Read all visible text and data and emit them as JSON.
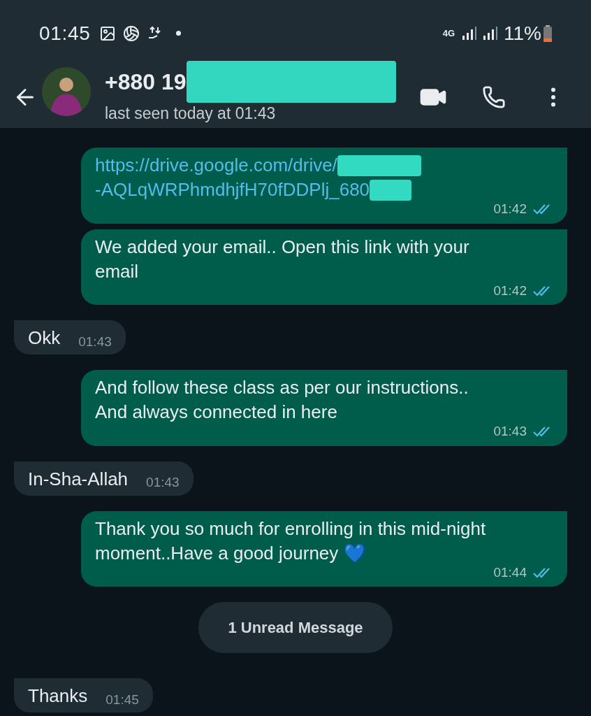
{
  "status_bar": {
    "time": "01:45",
    "network": "4G",
    "battery": "11%"
  },
  "header": {
    "name": "+880 19",
    "status": "last seen today at 01:43"
  },
  "messages": [
    {
      "kind": "link",
      "outgoing": true,
      "lines": [
        "https://drive.google.com/drive/",
        "-AQLqWRPhmdhjfH70fDDPlj_680"
      ],
      "time": "01:42",
      "read": true
    },
    {
      "kind": "text",
      "outgoing": true,
      "lines": [
        "We added your email.. Open this link with your",
        "email"
      ],
      "time": "01:42",
      "read": true
    },
    {
      "kind": "text",
      "outgoing": false,
      "lines": [
        "Okk"
      ],
      "time": "01:43"
    },
    {
      "kind": "text",
      "outgoing": true,
      "lines": [
        "And follow these class as per our instructions..",
        "And always connected in here"
      ],
      "time": "01:43",
      "read": true
    },
    {
      "kind": "text",
      "outgoing": false,
      "lines": [
        "In-Sha-Allah"
      ],
      "time": "01:43"
    },
    {
      "kind": "text",
      "outgoing": true,
      "lines": [
        "Thank you so much for enrolling in this mid-night",
        "moment..Have a good journey 💙"
      ],
      "time": "01:44",
      "read": true
    },
    {
      "kind": "divider",
      "label": "1 Unread Message"
    },
    {
      "kind": "text",
      "outgoing": false,
      "lines": [
        "Thanks"
      ],
      "time": "01:45"
    }
  ]
}
